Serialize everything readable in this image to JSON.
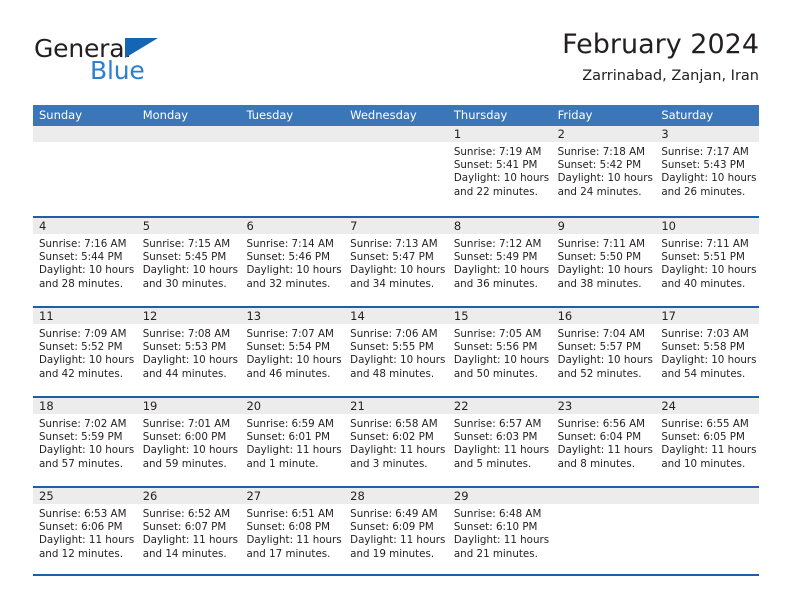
{
  "logo": {
    "word_top": "General",
    "word_bottom": "Blue",
    "triangle_icon": "triangle-icon",
    "color_dark": "#231f20",
    "color_blue": "#2e7fd0",
    "color_triangle": "#1565b5"
  },
  "header": {
    "title": "February 2024",
    "subtitle": "Zarrinabad, Zanjan, Iran"
  },
  "theme": {
    "header_blue": "#3a76b8",
    "rule_blue": "#1f5ea8",
    "day_band_gray": "#ececec",
    "text": "#231f20"
  },
  "weekdays": [
    "Sunday",
    "Monday",
    "Tuesday",
    "Wednesday",
    "Thursday",
    "Friday",
    "Saturday"
  ],
  "weeks": [
    [
      {
        "day": "",
        "empty": true,
        "lines": []
      },
      {
        "day": "",
        "empty": true,
        "lines": []
      },
      {
        "day": "",
        "empty": true,
        "lines": []
      },
      {
        "day": "",
        "empty": true,
        "lines": []
      },
      {
        "day": "1",
        "empty": false,
        "lines": [
          "Sunrise: 7:19 AM",
          "Sunset: 5:41 PM",
          "Daylight: 10 hours",
          "and 22 minutes."
        ]
      },
      {
        "day": "2",
        "empty": false,
        "lines": [
          "Sunrise: 7:18 AM",
          "Sunset: 5:42 PM",
          "Daylight: 10 hours",
          "and 24 minutes."
        ]
      },
      {
        "day": "3",
        "empty": false,
        "lines": [
          "Sunrise: 7:17 AM",
          "Sunset: 5:43 PM",
          "Daylight: 10 hours",
          "and 26 minutes."
        ]
      }
    ],
    [
      {
        "day": "4",
        "empty": false,
        "lines": [
          "Sunrise: 7:16 AM",
          "Sunset: 5:44 PM",
          "Daylight: 10 hours",
          "and 28 minutes."
        ]
      },
      {
        "day": "5",
        "empty": false,
        "lines": [
          "Sunrise: 7:15 AM",
          "Sunset: 5:45 PM",
          "Daylight: 10 hours",
          "and 30 minutes."
        ]
      },
      {
        "day": "6",
        "empty": false,
        "lines": [
          "Sunrise: 7:14 AM",
          "Sunset: 5:46 PM",
          "Daylight: 10 hours",
          "and 32 minutes."
        ]
      },
      {
        "day": "7",
        "empty": false,
        "lines": [
          "Sunrise: 7:13 AM",
          "Sunset: 5:47 PM",
          "Daylight: 10 hours",
          "and 34 minutes."
        ]
      },
      {
        "day": "8",
        "empty": false,
        "lines": [
          "Sunrise: 7:12 AM",
          "Sunset: 5:49 PM",
          "Daylight: 10 hours",
          "and 36 minutes."
        ]
      },
      {
        "day": "9",
        "empty": false,
        "lines": [
          "Sunrise: 7:11 AM",
          "Sunset: 5:50 PM",
          "Daylight: 10 hours",
          "and 38 minutes."
        ]
      },
      {
        "day": "10",
        "empty": false,
        "lines": [
          "Sunrise: 7:11 AM",
          "Sunset: 5:51 PM",
          "Daylight: 10 hours",
          "and 40 minutes."
        ]
      }
    ],
    [
      {
        "day": "11",
        "empty": false,
        "lines": [
          "Sunrise: 7:09 AM",
          "Sunset: 5:52 PM",
          "Daylight: 10 hours",
          "and 42 minutes."
        ]
      },
      {
        "day": "12",
        "empty": false,
        "lines": [
          "Sunrise: 7:08 AM",
          "Sunset: 5:53 PM",
          "Daylight: 10 hours",
          "and 44 minutes."
        ]
      },
      {
        "day": "13",
        "empty": false,
        "lines": [
          "Sunrise: 7:07 AM",
          "Sunset: 5:54 PM",
          "Daylight: 10 hours",
          "and 46 minutes."
        ]
      },
      {
        "day": "14",
        "empty": false,
        "lines": [
          "Sunrise: 7:06 AM",
          "Sunset: 5:55 PM",
          "Daylight: 10 hours",
          "and 48 minutes."
        ]
      },
      {
        "day": "15",
        "empty": false,
        "lines": [
          "Sunrise: 7:05 AM",
          "Sunset: 5:56 PM",
          "Daylight: 10 hours",
          "and 50 minutes."
        ]
      },
      {
        "day": "16",
        "empty": false,
        "lines": [
          "Sunrise: 7:04 AM",
          "Sunset: 5:57 PM",
          "Daylight: 10 hours",
          "and 52 minutes."
        ]
      },
      {
        "day": "17",
        "empty": false,
        "lines": [
          "Sunrise: 7:03 AM",
          "Sunset: 5:58 PM",
          "Daylight: 10 hours",
          "and 54 minutes."
        ]
      }
    ],
    [
      {
        "day": "18",
        "empty": false,
        "lines": [
          "Sunrise: 7:02 AM",
          "Sunset: 5:59 PM",
          "Daylight: 10 hours",
          "and 57 minutes."
        ]
      },
      {
        "day": "19",
        "empty": false,
        "lines": [
          "Sunrise: 7:01 AM",
          "Sunset: 6:00 PM",
          "Daylight: 10 hours",
          "and 59 minutes."
        ]
      },
      {
        "day": "20",
        "empty": false,
        "lines": [
          "Sunrise: 6:59 AM",
          "Sunset: 6:01 PM",
          "Daylight: 11 hours",
          "and 1 minute."
        ]
      },
      {
        "day": "21",
        "empty": false,
        "lines": [
          "Sunrise: 6:58 AM",
          "Sunset: 6:02 PM",
          "Daylight: 11 hours",
          "and 3 minutes."
        ]
      },
      {
        "day": "22",
        "empty": false,
        "lines": [
          "Sunrise: 6:57 AM",
          "Sunset: 6:03 PM",
          "Daylight: 11 hours",
          "and 5 minutes."
        ]
      },
      {
        "day": "23",
        "empty": false,
        "lines": [
          "Sunrise: 6:56 AM",
          "Sunset: 6:04 PM",
          "Daylight: 11 hours",
          "and 8 minutes."
        ]
      },
      {
        "day": "24",
        "empty": false,
        "lines": [
          "Sunrise: 6:55 AM",
          "Sunset: 6:05 PM",
          "Daylight: 11 hours",
          "and 10 minutes."
        ]
      }
    ],
    [
      {
        "day": "25",
        "empty": false,
        "lines": [
          "Sunrise: 6:53 AM",
          "Sunset: 6:06 PM",
          "Daylight: 11 hours",
          "and 12 minutes."
        ]
      },
      {
        "day": "26",
        "empty": false,
        "lines": [
          "Sunrise: 6:52 AM",
          "Sunset: 6:07 PM",
          "Daylight: 11 hours",
          "and 14 minutes."
        ]
      },
      {
        "day": "27",
        "empty": false,
        "lines": [
          "Sunrise: 6:51 AM",
          "Sunset: 6:08 PM",
          "Daylight: 11 hours",
          "and 17 minutes."
        ]
      },
      {
        "day": "28",
        "empty": false,
        "lines": [
          "Sunrise: 6:49 AM",
          "Sunset: 6:09 PM",
          "Daylight: 11 hours",
          "and 19 minutes."
        ]
      },
      {
        "day": "29",
        "empty": false,
        "lines": [
          "Sunrise: 6:48 AM",
          "Sunset: 6:10 PM",
          "Daylight: 11 hours",
          "and 21 minutes."
        ]
      },
      {
        "day": "",
        "empty": true,
        "lines": []
      },
      {
        "day": "",
        "empty": true,
        "lines": []
      }
    ]
  ]
}
